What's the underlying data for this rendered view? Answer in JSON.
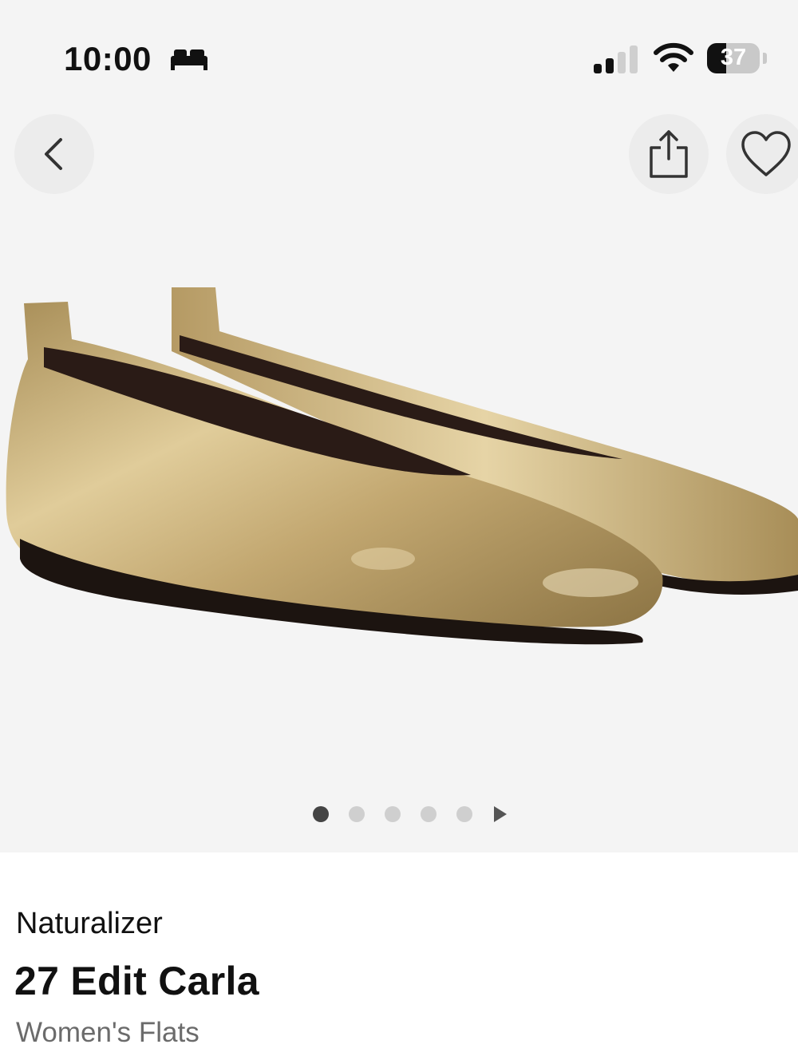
{
  "status_bar": {
    "time": "10:00",
    "battery_level": "37",
    "battery_fraction": 0.37,
    "signal_bars_lit": 2,
    "signal_bars_total": 4,
    "icons": [
      "sleep-focus-icon",
      "cellular-signal-icon",
      "wifi-icon",
      "battery-icon"
    ]
  },
  "nav": {
    "back_icon": "chevron-left-icon",
    "share_icon": "share-icon",
    "favorite_icon": "heart-outline-icon"
  },
  "gallery": {
    "image_count": 5,
    "current_index": 1,
    "next_icon": "play-triangle-icon"
  },
  "product": {
    "brand": "Naturalizer",
    "name": "27 Edit Carla",
    "category": "Women's Flats"
  },
  "colors": {
    "hero_background": "#f4f4f4",
    "shoe_gold": "#c9b078",
    "active_dot": "#444444",
    "inactive_dot": "#cfcfcf"
  }
}
